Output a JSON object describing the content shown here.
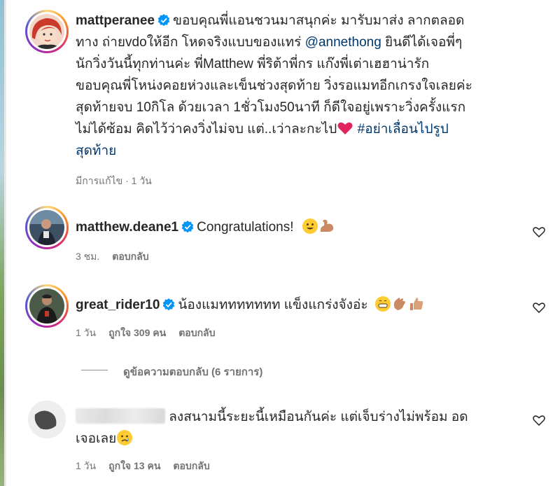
{
  "post": {
    "username": "mattperanee",
    "lines": [
      "ขอบคุณพี่แอนชวนมาสนุกค่ะ มารับมาส่ง ลากตลอด",
      "ทาง ถ่ายvdoให้อีก โหดจริงแบบของแทร่ ",
      "นักวิ่งวันนี้ทุกท่านค่ะ พี่Matthew พี่ริต้าพี่กร แก๊งพี่เต่าเฮฮาน่ารัก",
      "ขอบคุณพี่โหน่งคอยห่วงและเข็นช่วงสุดท้าย วิ่งรอแมทอีกเกรงใจเลยค่ะ",
      "สุดท้ายจบ 10กิโล ด้วยเวลา 1ชั่วโมง50นาที ก็ดีใจอยู่เพราะวิ่งครั้งแรก",
      "ไม่ได้ซ้อม คิดไว้ว่าคงวิ่งไม่จบ แต่..เว่าละกะไป",
      "สุดท้าย"
    ],
    "mention": "@annethong",
    "line2_tail": " ยินดีได้เจอพี่ๆ",
    "hashtag": "#อย่าเลื่อนไปรูป",
    "meta_edited": "มีการแก้ไข · 1 วัน"
  },
  "comments": [
    {
      "username": "matthew.deane1",
      "text": "Congratulations!",
      "time": "3 ชม.",
      "reply_label": "ตอบกลับ"
    },
    {
      "username": "great_rider10",
      "text": "น้องแมททททททท แข็งแกร่งจังอ่ะ",
      "time": "1 วัน",
      "likes": "ถูกใจ 309 คน",
      "reply_label": "ตอบกลับ",
      "view_replies": "ดูข้อความตอบกลับ (6 รายการ)"
    },
    {
      "text_line1": "ลงสนามนี้ระยะนี้เหมือนกันค่ะ แต่เจ็บร่างไม่พร้อม อด",
      "text_line2": "เจอเลย",
      "time": "1 วัน",
      "likes": "ถูกใจ 13 คน",
      "reply_label": "ตอบกลับ"
    }
  ],
  "colors": {
    "link": "#00376b",
    "verified": "#0095f6",
    "muted": "#737373"
  }
}
